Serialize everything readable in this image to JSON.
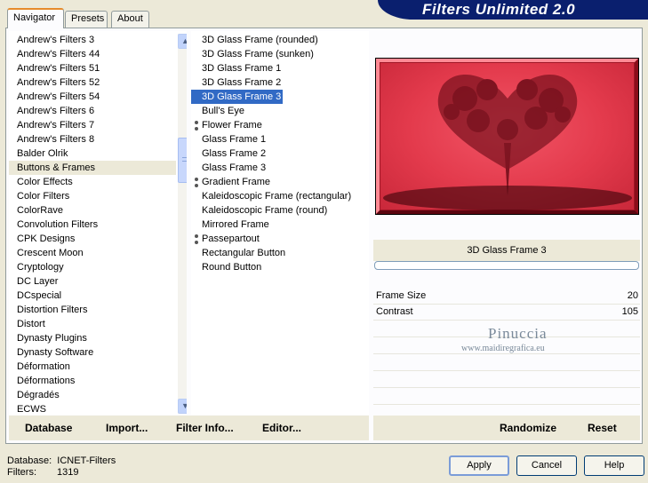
{
  "title": "Filters Unlimited 2.0",
  "tabs": [
    "Navigator",
    "Presets",
    "About"
  ],
  "categories": [
    "Andrew's Filters 3",
    "Andrew's Filters 44",
    "Andrew's Filters 51",
    "Andrew's Filters 52",
    "Andrew's Filters 54",
    "Andrew's Filters 6",
    "Andrew's Filters 7",
    "Andrew's Filters 8",
    "Balder Olrik",
    "Buttons & Frames",
    "Color Effects",
    "Color Filters",
    "ColorRave",
    "Convolution Filters",
    "CPK Designs",
    "Crescent Moon",
    "Cryptology",
    "DC Layer",
    "DCspecial",
    "Distortion Filters",
    "Distort",
    "Dynasty Plugins",
    "Dynasty Software",
    "Déformation",
    "Déformations",
    "Dégradés",
    "ECWS"
  ],
  "selected_category": "Buttons & Frames",
  "filters": [
    "3D Glass Frame (rounded)",
    "3D Glass Frame (sunken)",
    "3D Glass Frame 1",
    "3D Glass Frame 2",
    "3D Glass Frame 3",
    "Bull's Eye",
    "Flower Frame",
    "Glass Frame 1",
    "Glass Frame 2",
    "Glass Frame 3",
    "Gradient Frame",
    "Kaleidoscopic Frame (rectangular)",
    "Kaleidoscopic Frame (round)",
    "Mirrored Frame",
    "Passepartout",
    "Rectangular Button",
    "Round Button"
  ],
  "marked_filters": [
    "Flower Frame",
    "Gradient Frame",
    "Passepartout"
  ],
  "selected_filter": "3D Glass Frame 3",
  "preview_filter_name": "3D Glass Frame 3",
  "params": [
    {
      "name": "Frame Size",
      "value": "20"
    },
    {
      "name": "Contrast",
      "value": "105"
    }
  ],
  "watermark": {
    "line1": "Pinuccia",
    "line2": "www.maidiregrafica.eu"
  },
  "bottom_buttons": {
    "database": "Database",
    "import": "Import...",
    "filter_info": "Filter Info...",
    "editor": "Editor...",
    "randomize": "Randomize",
    "reset": "Reset"
  },
  "status": {
    "database_label": "Database:",
    "database_value": "ICNET-Filters",
    "filters_label": "Filters:",
    "filters_value": "1319"
  },
  "dialog_buttons": {
    "apply": "Apply",
    "cancel": "Cancel",
    "help": "Help"
  },
  "colors": {
    "banner": "#0a1f6e",
    "selection": "#316ac5",
    "preview": "#e6394b"
  }
}
